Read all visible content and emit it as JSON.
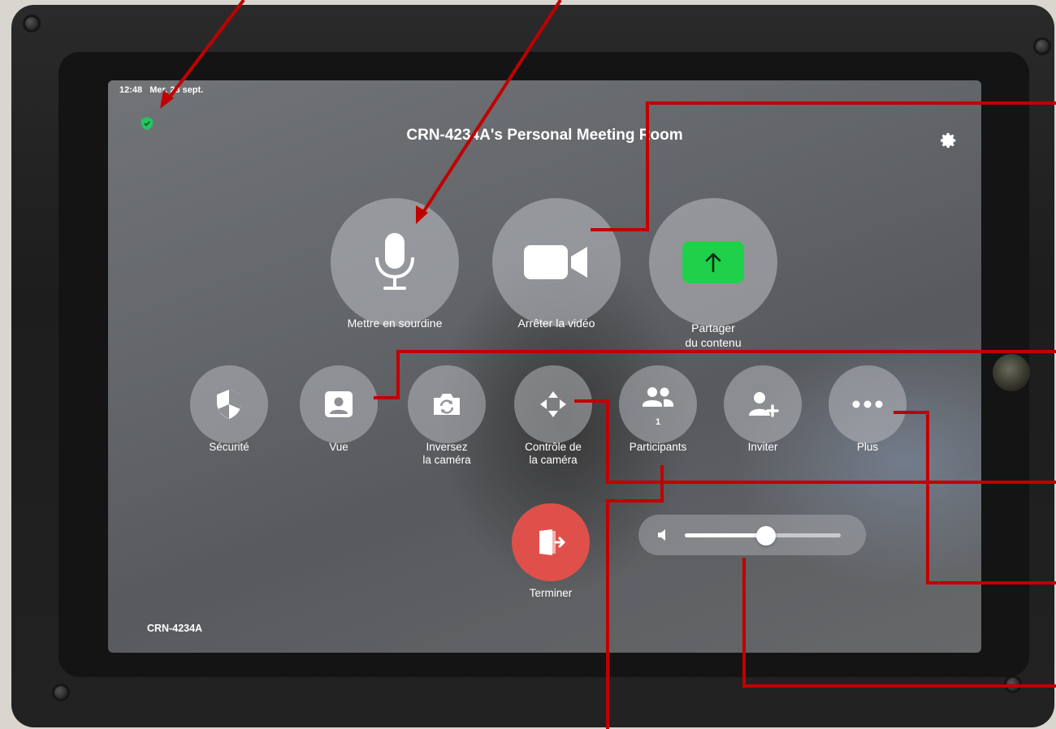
{
  "status_bar": {
    "time": "12:48",
    "date": "Mer. 28 sept."
  },
  "header": {
    "room_title": "CRN-4234A's Personal Meeting Room"
  },
  "main_controls": [
    {
      "label": "Mettre en sourdine",
      "icon": "microphone-icon"
    },
    {
      "label": "Arrêter la vidéo",
      "icon": "video-camera-icon"
    },
    {
      "label": "Partager du contenu",
      "icon": "share-arrow-icon"
    }
  ],
  "secondary_controls": [
    {
      "label": "Sécurité",
      "icon": "security-shield-icon"
    },
    {
      "label": "Vue",
      "icon": "user-view-icon"
    },
    {
      "label": "Inversez la caméra",
      "icon": "camera-flip-icon"
    },
    {
      "label": "Contrôle de la caméra",
      "icon": "camera-control-arrows-icon"
    },
    {
      "label": "Participants",
      "icon": "participants-icon",
      "count": "1"
    },
    {
      "label": "Inviter",
      "icon": "invite-user-icon"
    },
    {
      "label": "Plus",
      "icon": "more-dots-icon"
    }
  ],
  "end": {
    "label": "Terminer",
    "icon": "leave-meeting-icon"
  },
  "volume": {
    "level": 0.52,
    "icon": "speaker-icon"
  },
  "footer": {
    "device_name": "CRN-4234A"
  },
  "colors": {
    "end_red": "#e0504b",
    "share_green": "#1fd14a",
    "shield_green": "#22c55e",
    "annotation_red": "#c00000"
  }
}
